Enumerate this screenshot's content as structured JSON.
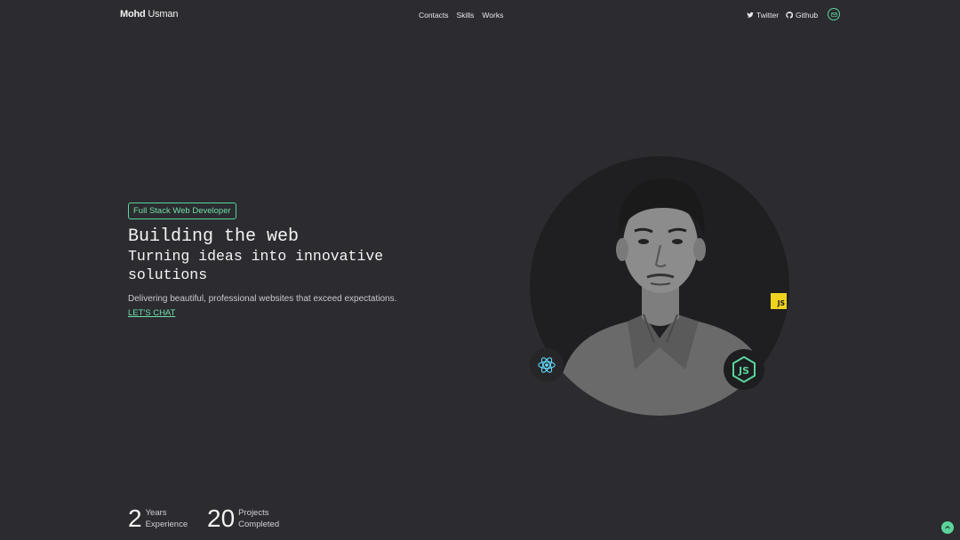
{
  "header": {
    "brand_bold": "Mohd",
    "brand_rest": "Usman",
    "nav": [
      "Contacts",
      "Skills",
      "Works"
    ],
    "social": [
      {
        "label": "Twitter",
        "icon": "twitter-icon"
      },
      {
        "label": "Github",
        "icon": "github-icon"
      }
    ],
    "mail_icon": "mail-icon"
  },
  "hero": {
    "badge": "Full Stack Web Developer",
    "title": "Building the web",
    "subtitle": "Turning ideas into innovative solutions",
    "description": "Delivering beautiful, professional websites that exceed expectations.",
    "cta": "LET'S CHAT"
  },
  "tech_badges": {
    "js": "JS",
    "react_icon": "react-icon",
    "node_icon": "nodejs-icon"
  },
  "stats": [
    {
      "number": "2",
      "line1": "Years",
      "line2": "Experience"
    },
    {
      "number": "20",
      "line1": "Projects",
      "line2": "Completed"
    }
  ],
  "colors": {
    "background": "#2b2b30",
    "accent": "#5ad49b",
    "js_yellow": "#f0d31e"
  }
}
